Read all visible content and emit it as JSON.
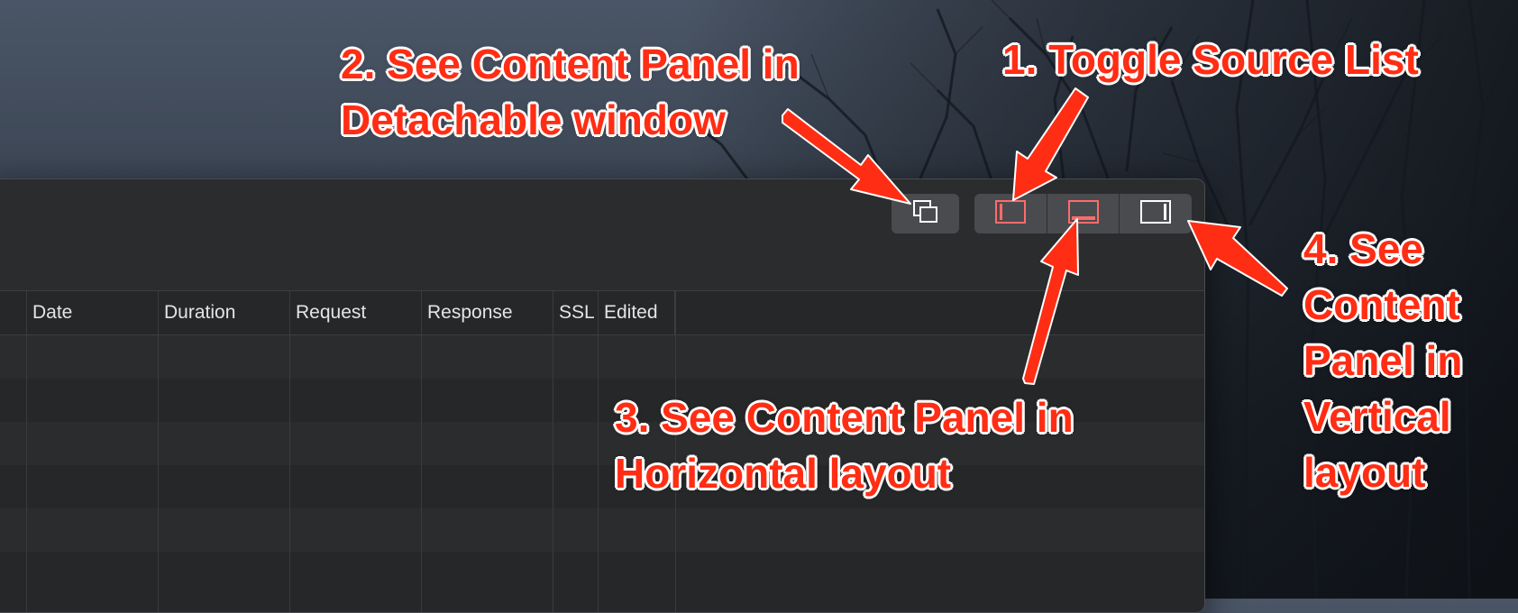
{
  "toolbar": {
    "detach_icon": "detach-window-icon",
    "layout_buttons": [
      {
        "icon": "toggle-source-list-icon",
        "state": "active"
      },
      {
        "icon": "horizontal-layout-icon",
        "state": "active"
      },
      {
        "icon": "vertical-layout-icon",
        "state": "inactive"
      }
    ]
  },
  "table": {
    "columns": [
      "Date",
      "Duration",
      "Request",
      "Response",
      "SSL",
      "Edited"
    ]
  },
  "annotations": {
    "toggle_source_list": "1. Toggle Source List",
    "detachable": "2. See Content Panel in\nDetachable window",
    "horizontal": "3. See Content Panel in\nHorizontal layout",
    "vertical": "4. See\nContent\nPanel in\nVertical\nlayout"
  },
  "colors": {
    "annotation": "#ff2d14",
    "icon_active": "#ff6b6b",
    "icon_inactive": "#ffffff"
  }
}
